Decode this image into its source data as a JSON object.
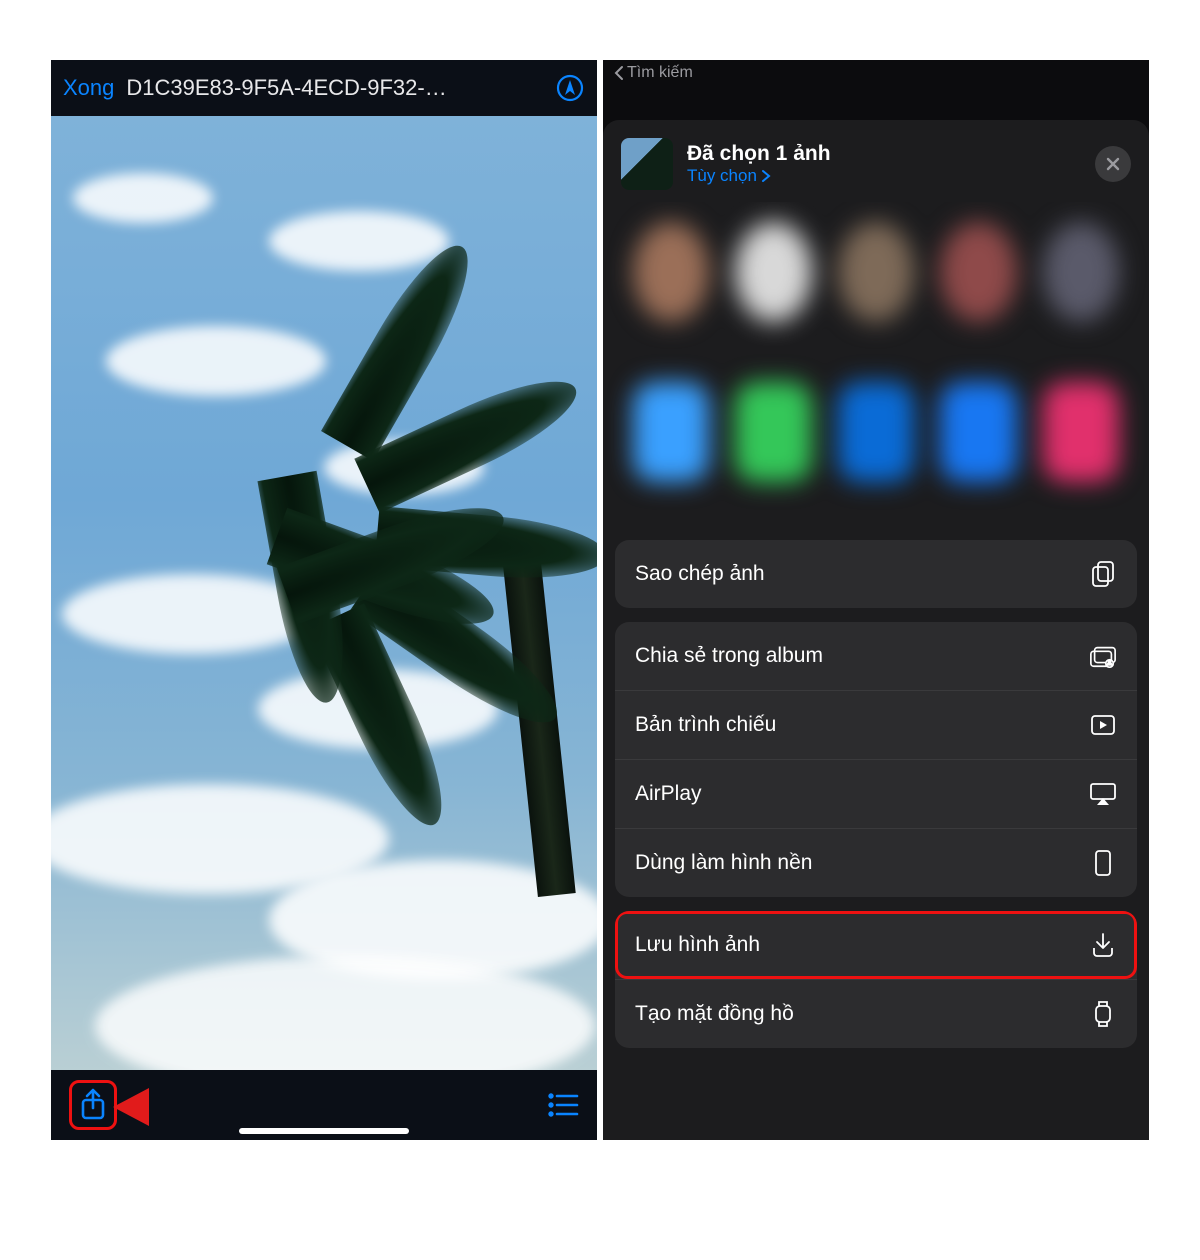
{
  "left": {
    "done_label": "Xong",
    "title": "D1C39E83-9F5A-4ECD-9F32-…",
    "icons": {
      "markup": "markup-icon",
      "share": "share-icon",
      "list": "list-icon"
    }
  },
  "right": {
    "back_label": "Tìm kiếm",
    "selected_label": "Đã chọn 1 ảnh",
    "options_label": "Tùy chọn",
    "blur_contacts_colors": [
      "#9b6f58",
      "#d8d8d8",
      "#7e6a58",
      "#8f4a4a",
      "#5a5a6a"
    ],
    "blur_apps_colors": [
      "#3aa0ff",
      "#34c759",
      "#0a6bd6",
      "#1877f2",
      "#e1306c"
    ],
    "actions": [
      {
        "group": 0,
        "label": "Sao chép ảnh",
        "icon": "copy-icon"
      },
      {
        "group": 1,
        "label": "Chia sẻ trong album",
        "icon": "album-share-icon"
      },
      {
        "group": 1,
        "label": "Bản trình chiếu",
        "icon": "slideshow-icon"
      },
      {
        "group": 1,
        "label": "AirPlay",
        "icon": "airplay-icon"
      },
      {
        "group": 1,
        "label": "Dùng làm hình nền",
        "icon": "wallpaper-icon"
      },
      {
        "group": 2,
        "label": "Lưu hình ảnh",
        "icon": "download-icon",
        "highlight": true
      },
      {
        "group": 2,
        "label": "Tạo mặt đồng hồ",
        "icon": "watch-icon"
      }
    ]
  },
  "colors": {
    "accent": "#0a84ff",
    "annotation": "#e11b1b"
  }
}
